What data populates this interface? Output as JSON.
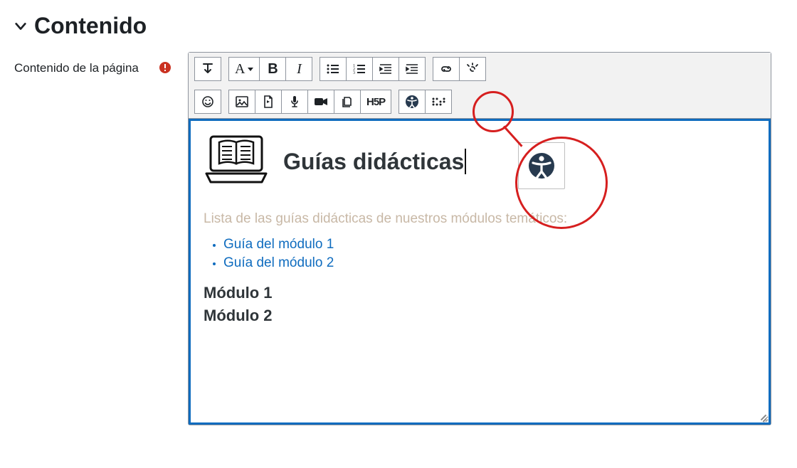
{
  "section": {
    "title": "Contenido",
    "field_label": "Contenido de la página"
  },
  "toolbar": {
    "row1": {
      "expand": "↧",
      "para_style": "A",
      "bold": "B",
      "italic": "I"
    },
    "h5p": "H5P"
  },
  "doc": {
    "title": "Guías didácticas",
    "subtitle": "Lista de las guías didácticas de nuestros módulos temáticos:",
    "links": [
      "Guía del módulo 1",
      "Guía del módulo 2"
    ],
    "modules": [
      "Módulo 1",
      "Módulo 2"
    ]
  }
}
